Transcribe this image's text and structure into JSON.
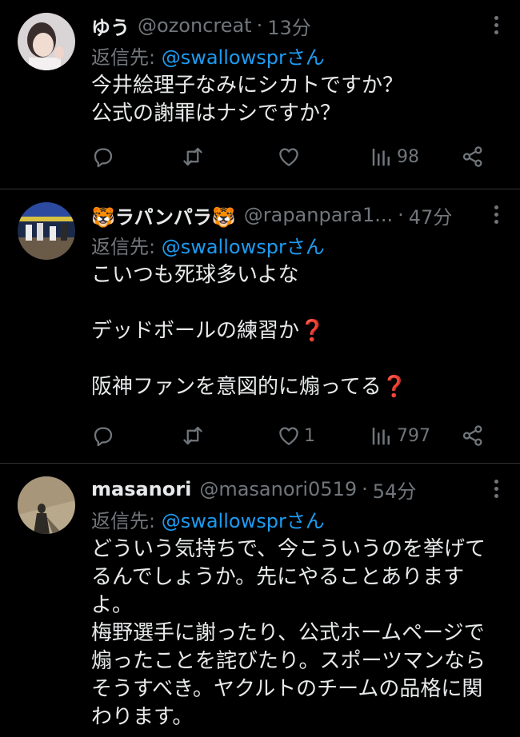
{
  "reply_label": "返信先: ",
  "tweets": [
    {
      "name": "ゆう",
      "handle": "@ozoncreat",
      "sep": "·",
      "time": "13分",
      "reply_to": "@swallowsprさん",
      "lines": [
        "今井絵理子なみにシカトですか？",
        "公式の謝罪はナシですか？"
      ],
      "likes": "",
      "views": "98"
    },
    {
      "name": "ラパンパラ",
      "name_emoji": "🐯",
      "handle": "@rapanpara1...",
      "sep": "·",
      "time": "47分",
      "reply_to": "@swallowsprさん",
      "lines": [
        "こいつも死球多いよな",
        "",
        "デッドボールの練習か",
        "",
        "阪神ファンを意図的に煽ってる"
      ],
      "question_mark": "❓",
      "likes": "1",
      "views": "797"
    },
    {
      "name": "masanori",
      "handle": "@masanori0519",
      "sep": "·",
      "time": "54分",
      "reply_to": "@swallowsprさん",
      "lines": [
        "どういう気持ちで、今こういうのを挙げて",
        "るんでしょうか。先にやることあります",
        "よ。",
        "梅野選手に謝ったり、公式ホームページで",
        "煽ったことを詫びたり。スポーツマンなら",
        "そうすべき。ヤクルトのチームの品格に関",
        "わります。"
      ]
    }
  ],
  "colors": {
    "background": "#000000",
    "text": "#e7e9ea",
    "muted": "#71767b",
    "mention": "#1d9bf0",
    "divider": "#2f3336"
  },
  "icons": [
    "reply-icon",
    "retweet-icon",
    "like-icon",
    "views-icon",
    "share-icon",
    "more-icon"
  ]
}
